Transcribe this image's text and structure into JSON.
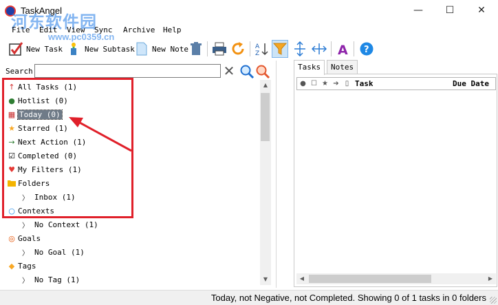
{
  "window": {
    "title": "TaskAngel",
    "watermark": "河东软件园",
    "watermark_url": "www.pc0359.cn",
    "minimize_glyph": "—",
    "maximize_glyph": "☐",
    "close_glyph": "✕"
  },
  "menu": [
    "File",
    "Edit",
    "View",
    "Sync",
    "Archive",
    "Help"
  ],
  "toolbar": {
    "new_task": "New Task",
    "new_subtask": "New Subtask",
    "new_note": "New Note",
    "icons": [
      "delete-icon",
      "print-icon",
      "refresh-icon",
      "sort-az-icon",
      "filter-icon",
      "expand-vertical-icon",
      "expand-horizontal-icon",
      "font-icon",
      "help-icon"
    ]
  },
  "search": {
    "label": "Search",
    "value": "",
    "placeholder": ""
  },
  "tree": [
    {
      "icon": "up-arrow-icon",
      "label": "All Tasks (1)",
      "level": 0
    },
    {
      "icon": "hotlist-icon",
      "label": "Hotlist (0)",
      "level": 0
    },
    {
      "icon": "calendar-icon",
      "label": "Today (0)",
      "level": 0,
      "selected": true
    },
    {
      "icon": "star-icon",
      "label": "Starred (1)",
      "level": 0
    },
    {
      "icon": "right-arrow-icon",
      "label": "Next Action (1)",
      "level": 0
    },
    {
      "icon": "checkbox-icon",
      "label": "Completed (0)",
      "level": 0
    },
    {
      "icon": "heart-icon",
      "label": "My Filters (1)",
      "level": 0
    },
    {
      "icon": "folder-icon",
      "label": "Folders",
      "level": 0
    },
    {
      "icon": "chevron-right-icon",
      "label": "Inbox (1)",
      "level": 1
    },
    {
      "icon": "circle-icon",
      "label": "Contexts",
      "level": 0
    },
    {
      "icon": "chevron-right-icon",
      "label": "No Context (1)",
      "level": 1
    },
    {
      "icon": "goal-icon",
      "label": "Goals",
      "level": 0
    },
    {
      "icon": "chevron-right-icon",
      "label": "No Goal (1)",
      "level": 1
    },
    {
      "icon": "tag-icon",
      "label": "Tags",
      "level": 0
    },
    {
      "icon": "chevron-right-icon",
      "label": "No Tag (1)",
      "level": 1
    }
  ],
  "tabs": [
    {
      "label": "Tasks",
      "active": true
    },
    {
      "label": "Notes",
      "active": false
    }
  ],
  "grid": {
    "columns": [
      "Task",
      "Due Date"
    ],
    "header_icons": [
      "status-dot-icon",
      "checkbox-icon",
      "star-icon",
      "next-action-icon",
      "note-icon"
    ]
  },
  "status": "Today, not Negative, not Completed.  Showing 0 of 1 tasks in 0 folders",
  "colors": {
    "selection": "#6f7b88",
    "highlight_border": "#e0202a",
    "accent": "#1e7be6"
  }
}
